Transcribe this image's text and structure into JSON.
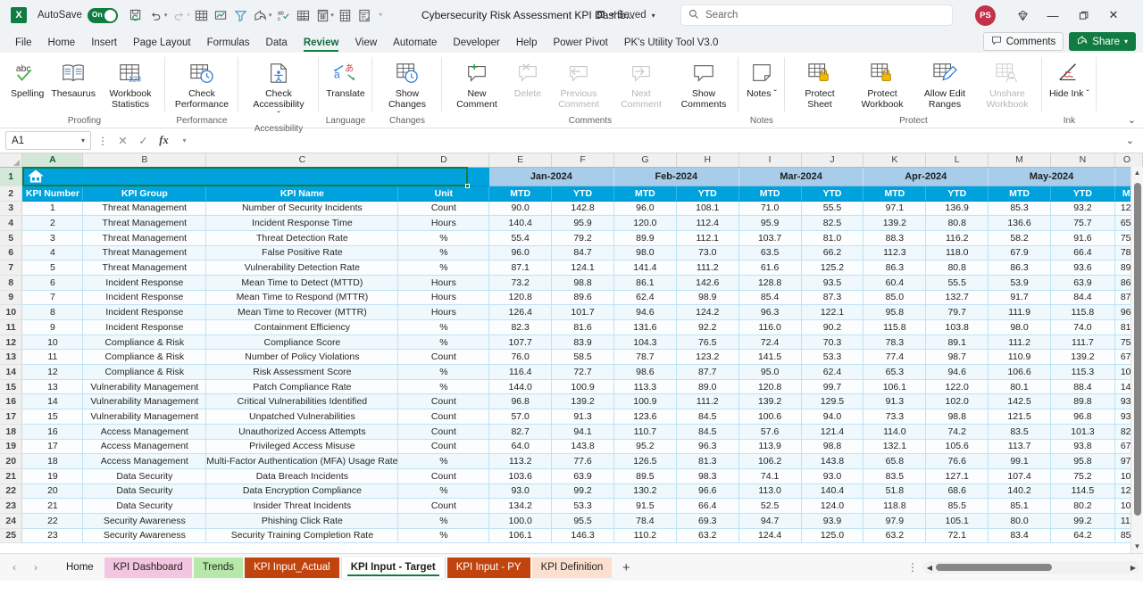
{
  "titlebar": {
    "app_logo": "excel-logo",
    "autosave_label": "AutoSave",
    "autosave_state": "On",
    "document_title": "Cybersecurity Risk Assessment KPI Dashb...",
    "save_status": "• Saved",
    "search_placeholder": "Search",
    "avatar_initials": "PS",
    "quick_access": [
      {
        "name": "save-icon",
        "glyph": "὚B"
      },
      {
        "name": "undo-icon",
        "glyph": "↶"
      },
      {
        "name": "redo-icon",
        "glyph": "↷"
      },
      {
        "name": "table-icon",
        "glyph": "⊞"
      },
      {
        "name": "chart-icon",
        "glyph": "Ὄ8"
      },
      {
        "name": "filter-icon",
        "glyph": "∇"
      },
      {
        "name": "share-arrow-icon",
        "glyph": "↪"
      },
      {
        "name": "spelling-icon",
        "glyph": "ab"
      },
      {
        "name": "grid-icon",
        "glyph": "▦"
      },
      {
        "name": "calculator-icon",
        "glyph": "⌸"
      },
      {
        "name": "pivot-icon",
        "glyph": "▤"
      },
      {
        "name": "form-icon",
        "glyph": "▥"
      }
    ],
    "window_controls": [
      "minimize",
      "restore",
      "close"
    ]
  },
  "ribbon": {
    "tabs": [
      {
        "label": "File",
        "active": false
      },
      {
        "label": "Home",
        "active": false
      },
      {
        "label": "Insert",
        "active": false
      },
      {
        "label": "Page Layout",
        "active": false
      },
      {
        "label": "Formulas",
        "active": false
      },
      {
        "label": "Data",
        "active": false
      },
      {
        "label": "Review",
        "active": true
      },
      {
        "label": "View",
        "active": false
      },
      {
        "label": "Automate",
        "active": false
      },
      {
        "label": "Developer",
        "active": false
      },
      {
        "label": "Help",
        "active": false
      },
      {
        "label": "Power Pivot",
        "active": false
      },
      {
        "label": "PK's Utility Tool V3.0",
        "active": false
      }
    ],
    "comments_label": "Comments",
    "share_label": "Share",
    "groups": [
      {
        "label": "Proofing",
        "commands": [
          {
            "label": "Spelling",
            "icon": "spelling-icon",
            "disabled": false
          },
          {
            "label": "Thesaurus",
            "icon": "thesaurus-icon",
            "disabled": false
          },
          {
            "label": "Workbook Statistics",
            "icon": "workbook-statistics-icon",
            "disabled": false
          }
        ]
      },
      {
        "label": "Performance",
        "commands": [
          {
            "label": "Check Performance",
            "icon": "check-performance-icon",
            "disabled": false
          }
        ]
      },
      {
        "label": "Accessibility",
        "commands": [
          {
            "label": "Check Accessibility ˇ",
            "icon": "check-accessibility-icon",
            "disabled": false
          }
        ]
      },
      {
        "label": "Language",
        "commands": [
          {
            "label": "Translate",
            "icon": "translate-icon",
            "disabled": false
          }
        ]
      },
      {
        "label": "Changes",
        "commands": [
          {
            "label": "Show Changes",
            "icon": "show-changes-icon",
            "disabled": false
          }
        ]
      },
      {
        "label": "Comments",
        "commands": [
          {
            "label": "New Comment",
            "icon": "new-comment-icon",
            "disabled": false
          },
          {
            "label": "Delete",
            "icon": "delete-comment-icon",
            "disabled": true
          },
          {
            "label": "Previous Comment",
            "icon": "previous-comment-icon",
            "disabled": true
          },
          {
            "label": "Next Comment",
            "icon": "next-comment-icon",
            "disabled": true
          },
          {
            "label": "Show Comments",
            "icon": "show-comments-icon",
            "disabled": false
          }
        ]
      },
      {
        "label": "Notes",
        "commands": [
          {
            "label": "Notes ˇ",
            "icon": "notes-icon",
            "disabled": false
          }
        ]
      },
      {
        "label": "Protect",
        "commands": [
          {
            "label": "Protect Sheet",
            "icon": "protect-sheet-icon",
            "disabled": false
          },
          {
            "label": "Protect Workbook",
            "icon": "protect-workbook-icon",
            "disabled": false
          },
          {
            "label": "Allow Edit Ranges",
            "icon": "allow-edit-ranges-icon",
            "disabled": false
          },
          {
            "label": "Unshare Workbook",
            "icon": "unshare-workbook-icon",
            "disabled": true
          }
        ]
      },
      {
        "label": "Ink",
        "commands": [
          {
            "label": "Hide Ink ˇ",
            "icon": "hide-ink-icon",
            "disabled": false
          }
        ]
      }
    ]
  },
  "formula_bar": {
    "name_box_value": "A1",
    "formula_value": "",
    "cancel_icon": "cancel-icon",
    "confirm_icon": "confirm-icon",
    "fx_icon": "insert-function-icon"
  },
  "grid": {
    "column_letters": [
      "A",
      "B",
      "C",
      "D",
      "E",
      "F",
      "G",
      "H",
      "I",
      "J",
      "K",
      "L",
      "M",
      "N",
      "O"
    ],
    "selected_column": "A",
    "selected_row": 1,
    "row_numbers": [
      1,
      2,
      3,
      4,
      5,
      6,
      7,
      8,
      9,
      10,
      11,
      12,
      13,
      14,
      15,
      16,
      17,
      18,
      19,
      20,
      21,
      22,
      23,
      24,
      25
    ],
    "row1_icon": "home-icon",
    "month_headers": [
      "Jan-2024",
      "Feb-2024",
      "Mar-2024",
      "Apr-2024",
      "May-2024"
    ],
    "sub_headers": [
      "MTD",
      "YTD",
      "MTD",
      "YTD",
      "MTD",
      "YTD",
      "MTD",
      "YTD",
      "MTD",
      "YTD",
      "MT"
    ],
    "table_headers": [
      "KPI Number",
      "KPI Group",
      "KPI Name",
      "Unit"
    ],
    "rows": [
      {
        "num": "1",
        "group": "Threat Management",
        "name": "Number of Security Incidents",
        "unit": "Count",
        "vals": [
          "90.0",
          "142.8",
          "96.0",
          "108.1",
          "71.0",
          "55.5",
          "97.1",
          "136.9",
          "85.3",
          "93.2",
          "12"
        ]
      },
      {
        "num": "2",
        "group": "Threat Management",
        "name": "Incident Response Time",
        "unit": "Hours",
        "vals": [
          "140.4",
          "95.9",
          "120.0",
          "112.4",
          "95.9",
          "82.5",
          "139.2",
          "80.8",
          "136.6",
          "75.7",
          "65"
        ]
      },
      {
        "num": "3",
        "group": "Threat Management",
        "name": "Threat Detection Rate",
        "unit": "%",
        "vals": [
          "55.4",
          "79.2",
          "89.9",
          "112.1",
          "103.7",
          "81.0",
          "88.3",
          "116.2",
          "58.2",
          "91.6",
          "75"
        ]
      },
      {
        "num": "4",
        "group": "Threat Management",
        "name": "False Positive Rate",
        "unit": "%",
        "vals": [
          "96.0",
          "84.7",
          "98.0",
          "73.0",
          "63.5",
          "66.2",
          "112.3",
          "118.0",
          "67.9",
          "66.4",
          "78"
        ]
      },
      {
        "num": "5",
        "group": "Threat Management",
        "name": "Vulnerability Detection Rate",
        "unit": "%",
        "vals": [
          "87.1",
          "124.1",
          "141.4",
          "111.2",
          "61.6",
          "125.2",
          "86.3",
          "80.8",
          "86.3",
          "93.6",
          "89"
        ]
      },
      {
        "num": "6",
        "group": "Incident Response",
        "name": "Mean Time to Detect (MTTD)",
        "unit": "Hours",
        "vals": [
          "73.2",
          "98.8",
          "86.1",
          "142.6",
          "128.8",
          "93.5",
          "60.4",
          "55.5",
          "53.9",
          "63.9",
          "86"
        ]
      },
      {
        "num": "7",
        "group": "Incident Response",
        "name": "Mean Time to Respond (MTTR)",
        "unit": "Hours",
        "vals": [
          "120.8",
          "89.6",
          "62.4",
          "98.9",
          "85.4",
          "87.3",
          "85.0",
          "132.7",
          "91.7",
          "84.4",
          "87"
        ]
      },
      {
        "num": "8",
        "group": "Incident Response",
        "name": "Mean Time to Recover (MTTR)",
        "unit": "Hours",
        "vals": [
          "126.4",
          "101.7",
          "94.6",
          "124.2",
          "96.3",
          "122.1",
          "95.8",
          "79.7",
          "111.9",
          "115.8",
          "96"
        ]
      },
      {
        "num": "9",
        "group": "Incident Response",
        "name": "Containment Efficiency",
        "unit": "%",
        "vals": [
          "82.3",
          "81.6",
          "131.6",
          "92.2",
          "116.0",
          "90.2",
          "115.8",
          "103.8",
          "98.0",
          "74.0",
          "81"
        ]
      },
      {
        "num": "10",
        "group": "Compliance & Risk",
        "name": "Compliance Score",
        "unit": "%",
        "vals": [
          "107.7",
          "83.9",
          "104.3",
          "76.5",
          "72.4",
          "70.3",
          "78.3",
          "89.1",
          "111.2",
          "111.7",
          "75"
        ]
      },
      {
        "num": "11",
        "group": "Compliance & Risk",
        "name": "Number of Policy Violations",
        "unit": "Count",
        "vals": [
          "76.0",
          "58.5",
          "78.7",
          "123.2",
          "141.5",
          "53.3",
          "77.4",
          "98.7",
          "110.9",
          "139.2",
          "67"
        ]
      },
      {
        "num": "12",
        "group": "Compliance & Risk",
        "name": "Risk Assessment Score",
        "unit": "%",
        "vals": [
          "116.4",
          "72.7",
          "98.6",
          "87.7",
          "95.0",
          "62.4",
          "65.3",
          "94.6",
          "106.6",
          "115.3",
          "10"
        ]
      },
      {
        "num": "13",
        "group": "Vulnerability Management",
        "name": "Patch Compliance Rate",
        "unit": "%",
        "vals": [
          "144.0",
          "100.9",
          "113.3",
          "89.0",
          "120.8",
          "99.7",
          "106.1",
          "122.0",
          "80.1",
          "88.4",
          "14"
        ]
      },
      {
        "num": "14",
        "group": "Vulnerability Management",
        "name": "Critical Vulnerabilities Identified",
        "unit": "Count",
        "vals": [
          "96.8",
          "139.2",
          "100.9",
          "111.2",
          "139.2",
          "129.5",
          "91.3",
          "102.0",
          "142.5",
          "89.8",
          "93"
        ]
      },
      {
        "num": "15",
        "group": "Vulnerability Management",
        "name": "Unpatched Vulnerabilities",
        "unit": "Count",
        "vals": [
          "57.0",
          "91.3",
          "123.6",
          "84.5",
          "100.6",
          "94.0",
          "73.3",
          "98.8",
          "121.5",
          "96.8",
          "93"
        ]
      },
      {
        "num": "16",
        "group": "Access Management",
        "name": "Unauthorized Access Attempts",
        "unit": "Count",
        "vals": [
          "82.7",
          "94.1",
          "110.7",
          "84.5",
          "57.6",
          "121.4",
          "114.0",
          "74.2",
          "83.5",
          "101.3",
          "82"
        ]
      },
      {
        "num": "17",
        "group": "Access Management",
        "name": "Privileged Access Misuse",
        "unit": "Count",
        "vals": [
          "64.0",
          "143.8",
          "95.2",
          "96.3",
          "113.9",
          "98.8",
          "132.1",
          "105.6",
          "113.7",
          "93.8",
          "67"
        ]
      },
      {
        "num": "18",
        "group": "Access Management",
        "name": "Multi-Factor Authentication (MFA) Usage Rate",
        "unit": "%",
        "vals": [
          "113.2",
          "77.6",
          "126.5",
          "81.3",
          "106.2",
          "143.8",
          "65.8",
          "76.6",
          "99.1",
          "95.8",
          "97"
        ]
      },
      {
        "num": "19",
        "group": "Data Security",
        "name": "Data Breach Incidents",
        "unit": "Count",
        "vals": [
          "103.6",
          "63.9",
          "89.5",
          "98.3",
          "74.1",
          "93.0",
          "83.5",
          "127.1",
          "107.4",
          "75.2",
          "10"
        ]
      },
      {
        "num": "20",
        "group": "Data Security",
        "name": "Data Encryption Compliance",
        "unit": "%",
        "vals": [
          "93.0",
          "99.2",
          "130.2",
          "96.6",
          "113.0",
          "140.4",
          "51.8",
          "68.6",
          "140.2",
          "114.5",
          "12"
        ]
      },
      {
        "num": "21",
        "group": "Data Security",
        "name": "Insider Threat Incidents",
        "unit": "Count",
        "vals": [
          "134.2",
          "53.3",
          "91.5",
          "66.4",
          "52.5",
          "124.0",
          "118.8",
          "85.5",
          "85.1",
          "80.2",
          "10"
        ]
      },
      {
        "num": "22",
        "group": "Security Awareness",
        "name": "Phishing Click Rate",
        "unit": "%",
        "vals": [
          "100.0",
          "95.5",
          "78.4",
          "69.3",
          "94.7",
          "93.9",
          "97.9",
          "105.1",
          "80.0",
          "99.2",
          "11"
        ]
      },
      {
        "num": "23",
        "group": "Security Awareness",
        "name": "Security Training Completion Rate",
        "unit": "%",
        "vals": [
          "106.1",
          "146.3",
          "110.2",
          "63.2",
          "124.4",
          "125.0",
          "63.2",
          "72.1",
          "83.4",
          "64.2",
          "85"
        ]
      }
    ]
  },
  "sheet_tabs": {
    "items": [
      {
        "label": "Home",
        "active": false,
        "color": "none"
      },
      {
        "label": "KPI Dashboard",
        "active": false,
        "color": "#f2c6e0"
      },
      {
        "label": "Trends",
        "active": false,
        "color": "#b5e8a9"
      },
      {
        "label": "KPI Input_Actual",
        "active": false,
        "color": "#c1440e"
      },
      {
        "label": "KPI Input - Target",
        "active": true,
        "color": "#fbe3d2"
      },
      {
        "label": "KPI Input - PY",
        "active": false,
        "color": "#c1440e"
      },
      {
        "label": "KPI Definition",
        "active": false,
        "color": "#fbe0d0"
      }
    ],
    "add_sheet_label": "+"
  },
  "colors": {
    "accent_green": "#107c41",
    "header_blue": "#00a2dd",
    "month_blue": "#a8cdea",
    "cell_border": "#bfe3f5"
  }
}
